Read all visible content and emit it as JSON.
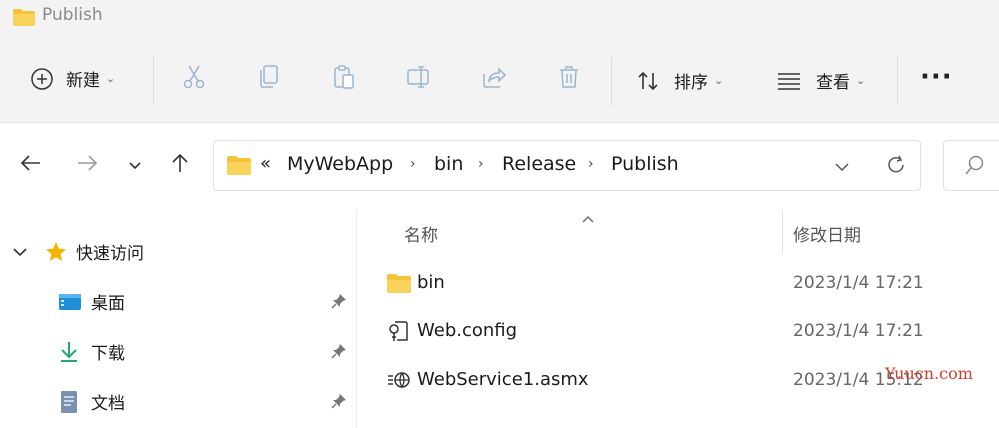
{
  "window": {
    "title": "Publish"
  },
  "toolbar": {
    "new_label": "新建",
    "sort_label": "排序",
    "view_label": "查看",
    "more_label": "···"
  },
  "address": {
    "overflow": "«",
    "crumbs": [
      "MyWebApp",
      "bin",
      "Release",
      "Publish"
    ]
  },
  "sidebar": {
    "quick_access": "快速访问",
    "items": [
      {
        "label": "桌面",
        "icon": "desktop-icon"
      },
      {
        "label": "下载",
        "icon": "download-icon"
      },
      {
        "label": "文档",
        "icon": "document-icon"
      }
    ]
  },
  "columns": {
    "name": "名称",
    "modified": "修改日期"
  },
  "files": [
    {
      "name": "bin",
      "modified": "2023/1/4 17:21",
      "icon": "folder-icon"
    },
    {
      "name": "Web.config",
      "modified": "2023/1/4 17:21",
      "icon": "config-file-icon"
    },
    {
      "name": "WebService1.asmx",
      "modified": "2023/1/4 15:12",
      "icon": "web-service-file-icon"
    }
  ],
  "watermark": "Yuucn.com",
  "colors": {
    "folder": "#f5c33b",
    "star": "#f5b400",
    "accent": "#0067c0",
    "watermark": "#d63a2b"
  }
}
